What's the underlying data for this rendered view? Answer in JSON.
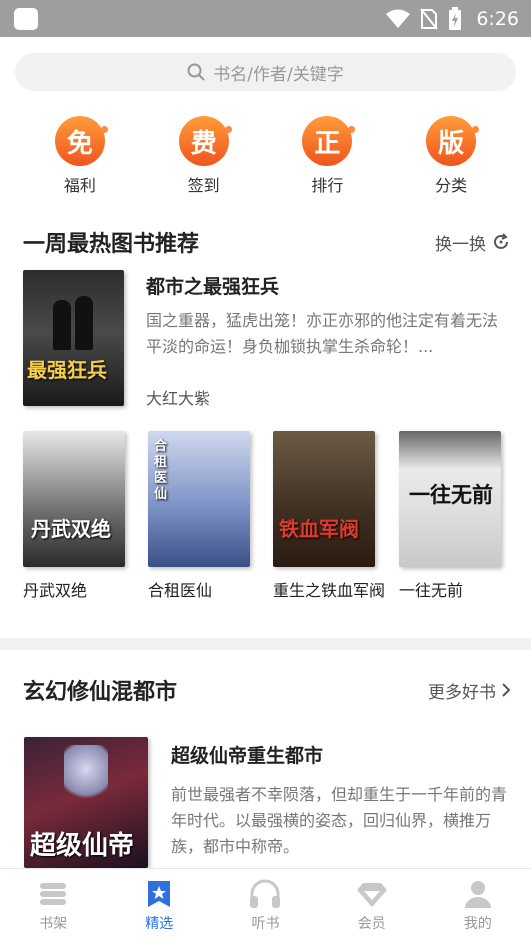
{
  "status": {
    "time": "6:26"
  },
  "search": {
    "placeholder": "书名/作者/关键字"
  },
  "quick_entries": [
    {
      "glyph": "免",
      "label": "福利"
    },
    {
      "glyph": "费",
      "label": "签到"
    },
    {
      "glyph": "正",
      "label": "排行"
    },
    {
      "glyph": "版",
      "label": "分类"
    }
  ],
  "section1": {
    "title": "一周最热图书推荐",
    "action": "换一换",
    "featured": {
      "title": "都市之最强狂兵",
      "desc": "国之重器，猛虎出笼！亦正亦邪的他注定有着无法平淡的命运！身负枷锁执掌生杀命轮！...",
      "author": "大红大紫",
      "cover_text": "最强狂兵"
    },
    "grid": [
      {
        "name": "丹武双绝",
        "cover_text": "丹武双绝"
      },
      {
        "name": "合租医仙",
        "cover_text": "合租医仙"
      },
      {
        "name": "重生之铁血军阀",
        "cover_text": "铁血军阀"
      },
      {
        "name": "一往无前",
        "cover_text": "一往无前"
      }
    ]
  },
  "section2": {
    "title": "玄幻修仙混都市",
    "action": "更多好书",
    "featured": {
      "title": "超级仙帝重生都市",
      "desc": "前世最强者不幸陨落，但却重生于一千年前的青年时代。以最强横的姿态，回归仙界，横推万族，都市中称帝。",
      "cover_text": "超级仙帝"
    }
  },
  "tabs": [
    {
      "label": "书架",
      "icon": "bookshelf-icon"
    },
    {
      "label": "精选",
      "icon": "star-bookmark-icon"
    },
    {
      "label": "听书",
      "icon": "headphones-icon"
    },
    {
      "label": "会员",
      "icon": "diamond-icon"
    },
    {
      "label": "我的",
      "icon": "person-icon"
    }
  ],
  "colors": {
    "accent": "#2f6fe0",
    "orange": "#f0541e"
  }
}
